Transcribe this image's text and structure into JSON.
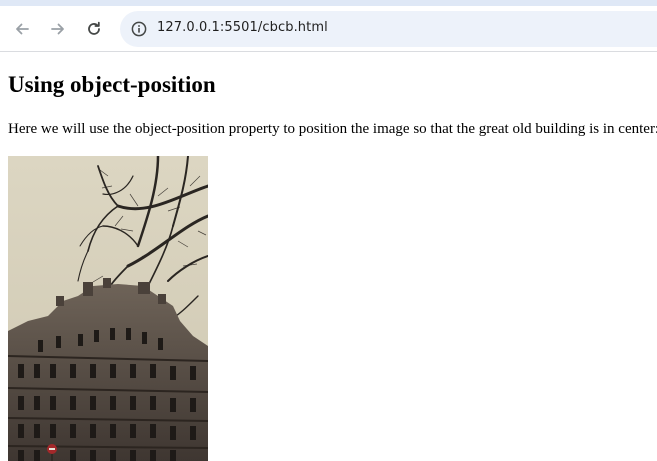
{
  "browser": {
    "url": "127.0.0.1:5501/cbcb.html",
    "icons": {
      "back": "arrow-left-icon",
      "forward": "arrow-right-icon",
      "reload": "reload-icon",
      "site_info": "info-icon"
    }
  },
  "page": {
    "heading": "Using object-position",
    "description": "Here we will use the object-position property to position the image so that the great old building is in center:"
  },
  "colors": {
    "toolbar_bg": "#ffffff",
    "omnibox_bg": "#edf2fa",
    "icon_disabled": "#9aa0a6",
    "icon_active": "#444746"
  }
}
